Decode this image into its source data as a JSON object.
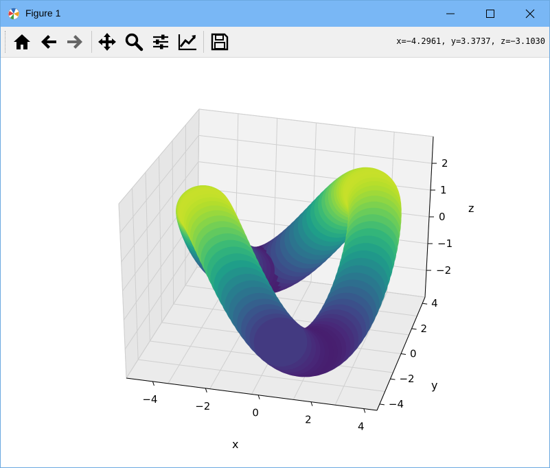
{
  "window": {
    "title": "Figure 1"
  },
  "toolbar": {
    "home": "home-icon",
    "back": "arrow-left-icon",
    "forward": "arrow-right-icon",
    "pan": "move-icon",
    "zoom": "zoom-icon",
    "subplots": "sliders-icon",
    "customize": "line-chart-icon",
    "save": "floppy-icon"
  },
  "status": {
    "coords": "x=−4.2961, y=3.3737, z=−3.1030"
  },
  "chart_data": {
    "type": "surface",
    "surface": "torus-knot-like tube, colored by z (viridis)",
    "colormap": "viridis",
    "xlabel": "x",
    "ylabel": "y",
    "zlabel": "z",
    "xlim": [
      -5,
      4.5
    ],
    "ylim": [
      -4.5,
      4.5
    ],
    "zlim": [
      -3,
      3
    ],
    "xticks": [
      "−4",
      "−2",
      "0",
      "2",
      "4"
    ],
    "yticks": [
      "−4",
      "−2",
      "0",
      "2",
      "4"
    ],
    "zticks": [
      "−2",
      "−1",
      "0",
      "1",
      "2"
    ],
    "grid": true
  }
}
